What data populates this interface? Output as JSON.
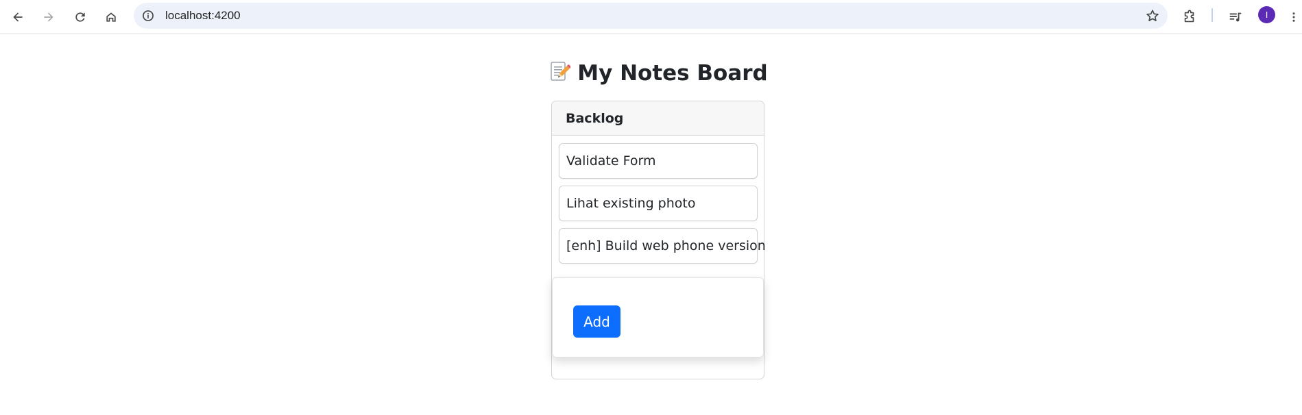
{
  "browser": {
    "url": "localhost:4200",
    "avatar_initial": "I",
    "icons": {
      "back": "arrow-left-icon",
      "forward": "arrow-right-icon",
      "reload": "reload-icon",
      "home": "home-icon",
      "site_info": "info-icon",
      "bookmark": "star-icon",
      "extensions": "puzzle-icon",
      "media": "media-queue-icon",
      "menu": "kebab-menu-icon"
    }
  },
  "page": {
    "title_emoji": "📝",
    "title": "My Notes Board"
  },
  "board": {
    "column_title": "Backlog",
    "notes": [
      {
        "text": "Validate Form"
      },
      {
        "text": "Lihat existing photo"
      },
      {
        "text": "[enh] Build web phone version"
      }
    ],
    "add_label": "Add"
  },
  "colors": {
    "primary": "#0d6efd",
    "avatar": "#5b2bb5",
    "omnibox": "#edf2fa"
  }
}
